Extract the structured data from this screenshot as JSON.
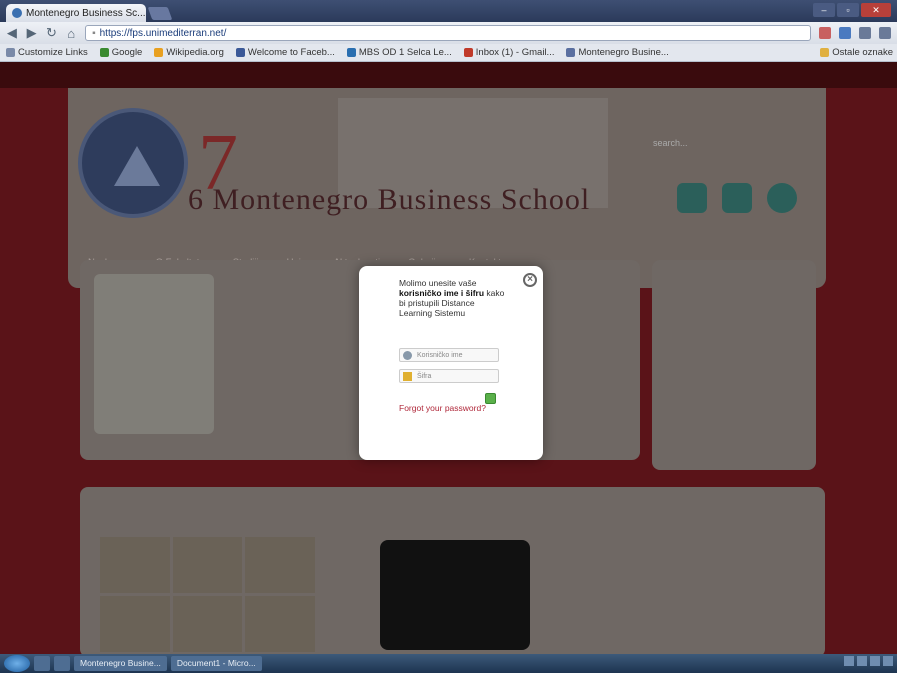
{
  "browser": {
    "tab_title": "Montenegro Business Sc...",
    "tab_close": "×",
    "url": "https://fps.unimediterran.net/",
    "window_controls": [
      "–",
      "▫",
      "✕"
    ]
  },
  "bookmarks": [
    {
      "label": "Customize Links",
      "color": "#7a8aa8"
    },
    {
      "label": "Google",
      "color": "#3a8a30"
    },
    {
      "label": "Wikipedia.org",
      "color": "#e8a020"
    },
    {
      "label": "Welcome to Faceb...",
      "color": "#3b5998"
    },
    {
      "label": "MBS OD 1 Selca Le...",
      "color": "#2a6fb0"
    },
    {
      "label": "Inbox (1) - Gmail...",
      "color": "#c03a2a"
    },
    {
      "label": "Montenegro Busine...",
      "color": "#5a6fa0"
    }
  ],
  "other_bookmarks": "Ostale oznake",
  "site": {
    "title": "Montenegro Business School",
    "big_number": "7",
    "small_number": "6",
    "search_placeholder": "search...",
    "menu": [
      "Naslovna",
      "O Fakultetu",
      "Studiji",
      "Upis",
      "Aktuelnosti",
      "Galerija",
      "Kontakt"
    ]
  },
  "modal": {
    "message_prefix": "Molimo unesite vaše ",
    "message_bold": "korisničko ime i šifru",
    "message_suffix": " kako bi pristupili Distance Learning Sistemu",
    "username_placeholder": "Korisničko ime",
    "password_placeholder": "Šifra",
    "close_glyph": "×",
    "forgot_label": "Forgot your password?"
  },
  "taskbar": {
    "tasks": [
      "Montenegro Busine...",
      "Document1 - Micro..."
    ]
  }
}
